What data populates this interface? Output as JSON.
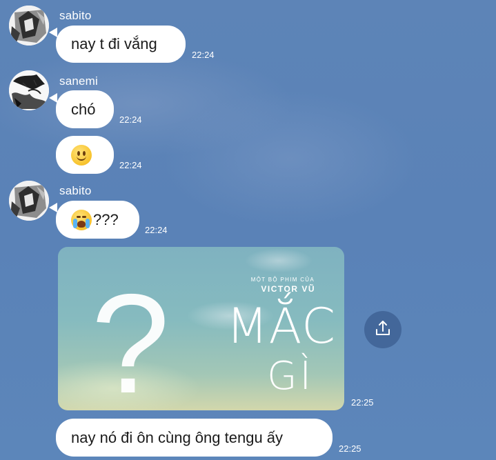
{
  "messages": [
    {
      "sender": "sabito",
      "text": "nay t đi vắng",
      "time": "22:24"
    },
    {
      "sender": "sanemi",
      "text": "chó",
      "time": "22:24"
    },
    {
      "emoji": "slightly-smiling-face",
      "time": "22:24"
    },
    {
      "sender": "sabito",
      "emoji": "loudly-crying-face",
      "text": "???",
      "time": "22:24"
    },
    {
      "image": {
        "subtitle": "MỘT BỘ PHIM CỦA",
        "director": "VICTOR VŨ",
        "title_line1": "MẮC",
        "title_line2": "GÌ",
        "question_mark": "?"
      },
      "time": "22:25"
    },
    {
      "text": "nay nó đi ôn cùng ông tengu ấy",
      "time": "22:25"
    }
  ],
  "icons": {
    "share": "share-upload-icon"
  },
  "colors": {
    "background": "#5a82b7",
    "bubble": "#ffffff",
    "text": "#1b1b1b",
    "share_button": "#43679a"
  }
}
